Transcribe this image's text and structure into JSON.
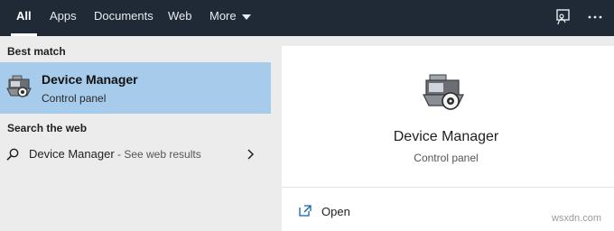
{
  "tabs": [
    {
      "label": "All",
      "active": true
    },
    {
      "label": "Apps"
    },
    {
      "label": "Documents"
    },
    {
      "label": "Web"
    },
    {
      "label": "More"
    }
  ],
  "toolbar": {
    "feedback_icon": "feedback-icon",
    "more_icon": "ellipsis-icon"
  },
  "left": {
    "best_match_label": "Best match",
    "best_match": {
      "title": "Device Manager",
      "subtitle": "Control panel",
      "icon": "device-manager-icon"
    },
    "search_web_label": "Search the web",
    "web_result": {
      "query": "Device Manager",
      "suffix": " - See web results",
      "icon": "search-icon"
    }
  },
  "right": {
    "title": "Device Manager",
    "subtitle": "Control panel",
    "actions": [
      {
        "label": "Open",
        "icon": "open-icon"
      }
    ]
  },
  "watermark": "wsxdn.com",
  "colors": {
    "topbar_bg": "#1f2a36",
    "selected_bg": "#a7cbea",
    "panel_bg": "#ececec",
    "accent": "#0a63b2"
  }
}
